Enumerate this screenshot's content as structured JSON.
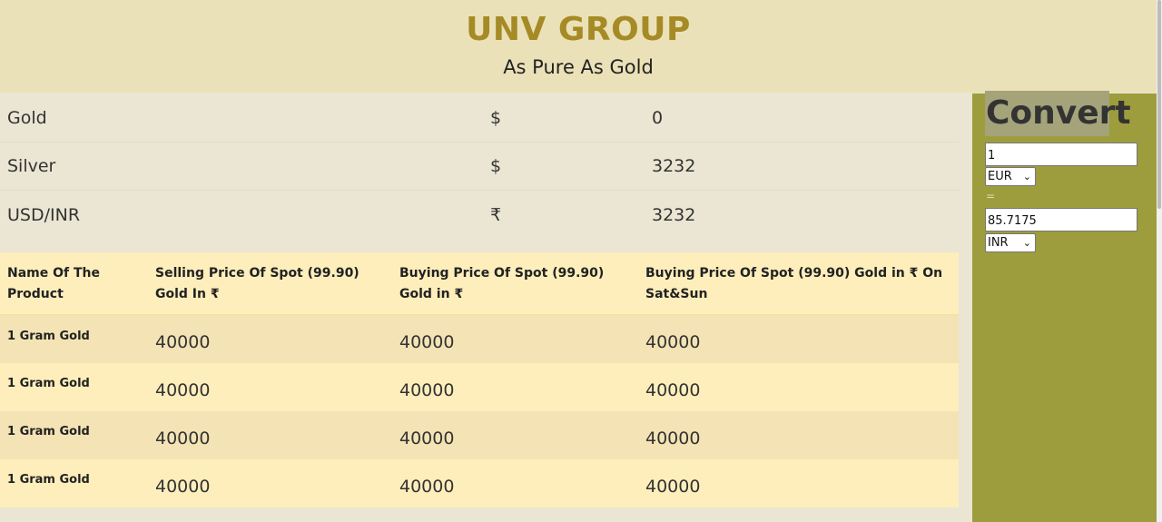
{
  "header": {
    "brand": "UNV GROUP",
    "tagline": "As Pure As Gold"
  },
  "rates": [
    {
      "name": "Gold",
      "currency": "$",
      "value": "0"
    },
    {
      "name": "Silver",
      "currency": "$",
      "value": "3232"
    },
    {
      "name": "USD/INR",
      "currency": "₹",
      "value": "3232"
    }
  ],
  "price_table": {
    "headers": [
      "Name Of The Product",
      "Selling Price Of Spot (99.90) Gold In ₹",
      "Buying Price Of Spot (99.90) Gold in ₹",
      "Buying Price Of Spot (99.90) Gold in ₹ On Sat&Sun"
    ],
    "rows": [
      [
        "1 Gram Gold",
        "40000",
        "40000",
        "40000"
      ],
      [
        "1 Gram Gold",
        "40000",
        "40000",
        "40000"
      ],
      [
        "1 Gram Gold",
        "40000",
        "40000",
        "40000"
      ],
      [
        "1 Gram Gold",
        "40000",
        "40000",
        "40000"
      ]
    ]
  },
  "converter": {
    "title": "Convert",
    "from_amount": "1",
    "from_currency": "EUR",
    "equals": "=",
    "to_amount": "85.7175",
    "to_currency": "INR",
    "arrow_icon": "chevron-down-icon"
  },
  "colors": {
    "header_bg": "#ebe1b8",
    "brand": "#a58a25",
    "converter_bg": "#9d9d3d",
    "table_header_bg": "#feeebc",
    "table_row_alt_bg": "#f4e3b4"
  }
}
